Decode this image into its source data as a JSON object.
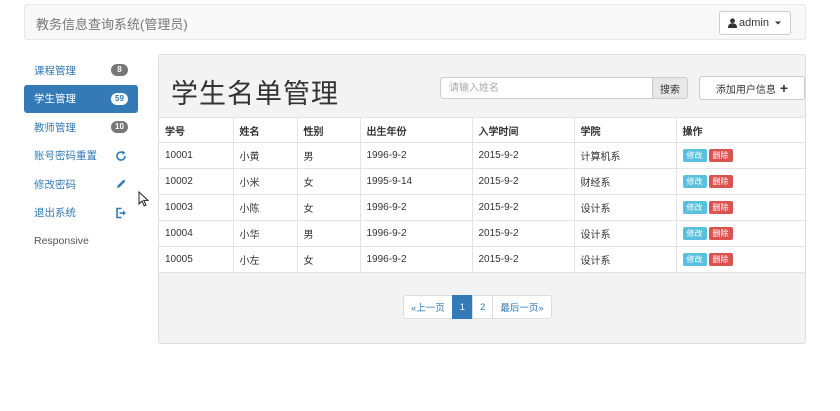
{
  "navbar": {
    "brand": "教务信息查询系统(管理员)",
    "user_label": "admin"
  },
  "sidebar": {
    "items": [
      {
        "label": "课程管理",
        "badge": "8"
      },
      {
        "label": "学生管理",
        "badge": "59",
        "active": true
      },
      {
        "label": "教师管理",
        "badge": "10"
      },
      {
        "label": "账号密码重置",
        "icon": "refresh-icon"
      },
      {
        "label": "修改密码",
        "icon": "pencil-icon"
      },
      {
        "label": "退出系统",
        "icon": "logout-icon"
      },
      {
        "label": "Responsive"
      }
    ]
  },
  "main": {
    "title": "学生名单管理",
    "search": {
      "placeholder": "请输入姓名",
      "button_label": "搜索"
    },
    "add_button_label": "添加用户信息"
  },
  "table": {
    "columns": [
      "学号",
      "姓名",
      "性别",
      "出生年份",
      "入学时间",
      "学院",
      "操作"
    ],
    "rows": [
      {
        "id": "10001",
        "name": "小黄",
        "gender": "男",
        "birth": "1996-9-2",
        "enroll": "2015-9-2",
        "college": "计算机系"
      },
      {
        "id": "10002",
        "name": "小米",
        "gender": "女",
        "birth": "1995-9-14",
        "enroll": "2015-9-2",
        "college": "财经系"
      },
      {
        "id": "10003",
        "name": "小陈",
        "gender": "女",
        "birth": "1996-9-2",
        "enroll": "2015-9-2",
        "college": "设计系"
      },
      {
        "id": "10004",
        "name": "小华",
        "gender": "男",
        "birth": "1996-9-2",
        "enroll": "2015-9-2",
        "college": "设计系"
      },
      {
        "id": "10005",
        "name": "小左",
        "gender": "女",
        "birth": "1996-9-2",
        "enroll": "2015-9-2",
        "college": "设计系"
      }
    ],
    "edit_label": "修改",
    "delete_label": "删除"
  },
  "pagination": {
    "prev_label": "«上一页",
    "pages": [
      "1",
      "2"
    ],
    "current_page": "1",
    "last_label": "最后一页»"
  },
  "colors": {
    "primary": "#337ab7",
    "info": "#5bc0de",
    "danger": "#d9534f",
    "badge": "#777777"
  }
}
